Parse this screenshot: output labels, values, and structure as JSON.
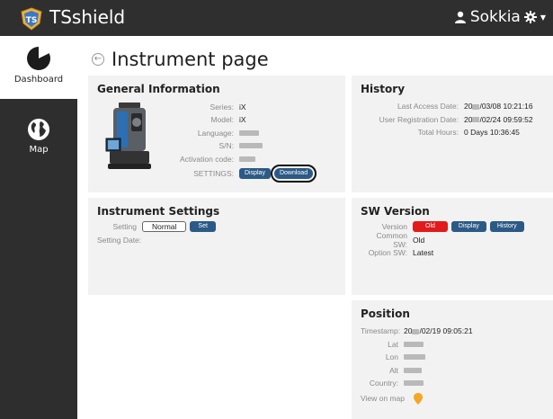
{
  "app": {
    "title": "TSshield",
    "user": "Sokkia"
  },
  "sidebar": {
    "items": [
      {
        "label": "Dashboard",
        "icon": "pie-chart-icon"
      },
      {
        "label": "Map",
        "icon": "globe-icon"
      }
    ]
  },
  "page": {
    "title": "Instrument page"
  },
  "general": {
    "title": "General Information",
    "series_label": "Series:",
    "series": "iX",
    "model_label": "Model:",
    "model": "iX",
    "language_label": "Language:",
    "sn_label": "S/N:",
    "activation_label": "Activation code:",
    "settings_label": "SETTINGS:",
    "display_btn": "Display",
    "download_btn": "Download"
  },
  "history": {
    "title": "History",
    "last_access_label": "Last Access Date:",
    "last_access_a": "20",
    "last_access_b": "/03/08 10:21:16",
    "registration_label": "User Registration Date:",
    "registration_a": "20",
    "registration_b": "/02/24 09:59:52",
    "hours_label": "Total Hours:",
    "hours": "0 Days 10:36:45"
  },
  "instrument_settings": {
    "title": "Instrument Settings",
    "setting_label": "Setting",
    "setting_value": "Normal",
    "set_btn": "Set",
    "setting_date_label": "Setting Date:"
  },
  "sw_version": {
    "title": "SW Version",
    "version_label": "Version",
    "old_btn": "Old",
    "display_btn": "Display",
    "history_btn": "History",
    "common_label": "Common SW:",
    "common_value": "Old",
    "option_label": "Option SW:",
    "option_value": "Latest"
  },
  "position": {
    "title": "Position",
    "timestamp_label": "Timestamp:",
    "timestamp_a": "20",
    "timestamp_b": "/02/19 09:05:21",
    "lat_label": "Lat",
    "lon_label": "Lon",
    "alt_label": "Alt",
    "country_label": "Country:",
    "view_map_label": "View on map"
  },
  "colors": {
    "topbar": "#2f2f2f",
    "button": "#2b5a86",
    "danger": "#e11b1b",
    "pin": "#f5a623"
  }
}
